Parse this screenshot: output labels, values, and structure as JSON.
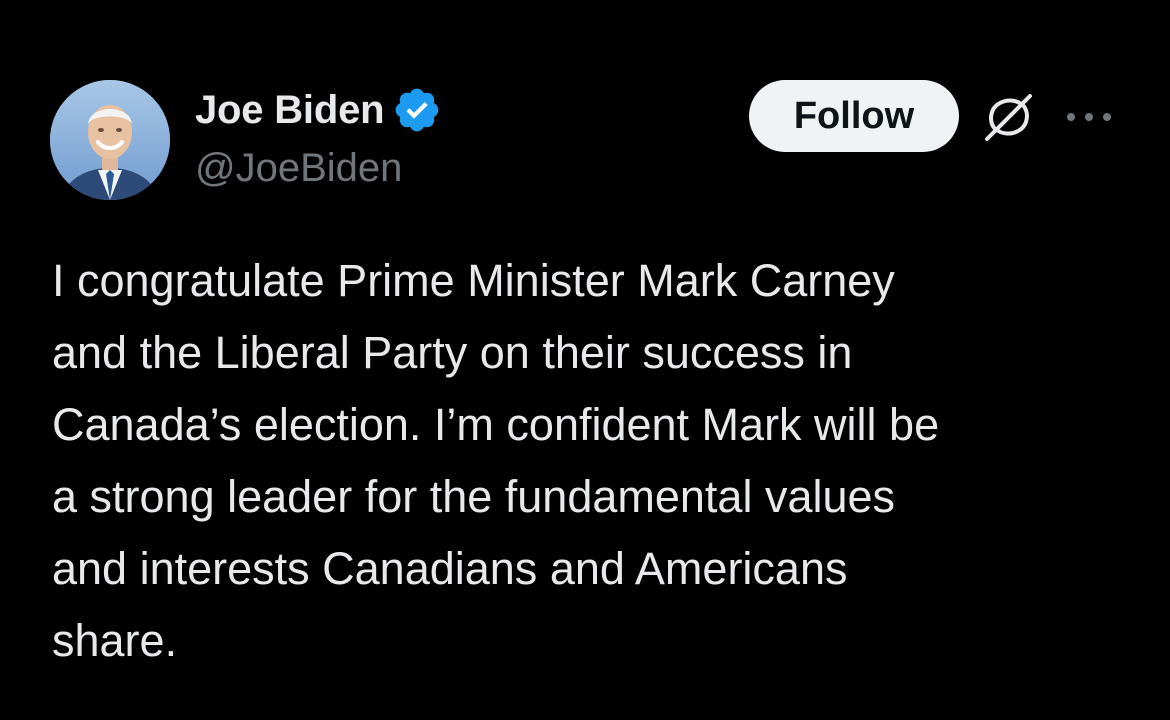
{
  "author": {
    "display_name": "Joe Biden",
    "handle": "@JoeBiden",
    "verified_icon": "verified-badge-icon",
    "avatar_alt": "Joe Biden"
  },
  "actions": {
    "follow_label": "Follow",
    "grok_icon": "grok-icon",
    "more_icon": "more-icon"
  },
  "tweet": {
    "text": "I congratulate Prime Minister Mark Carney\nand the Liberal Party on their success in\nCanada’s election.  I’m confident Mark will be\na strong leader for the fundamental values\nand interests Canadians and Americans\nshare."
  },
  "colors": {
    "background": "#000000",
    "text_primary": "#e7e9ea",
    "text_secondary": "#71767b",
    "verified_blue": "#1d9bf0",
    "follow_bg": "#eff3f4"
  }
}
